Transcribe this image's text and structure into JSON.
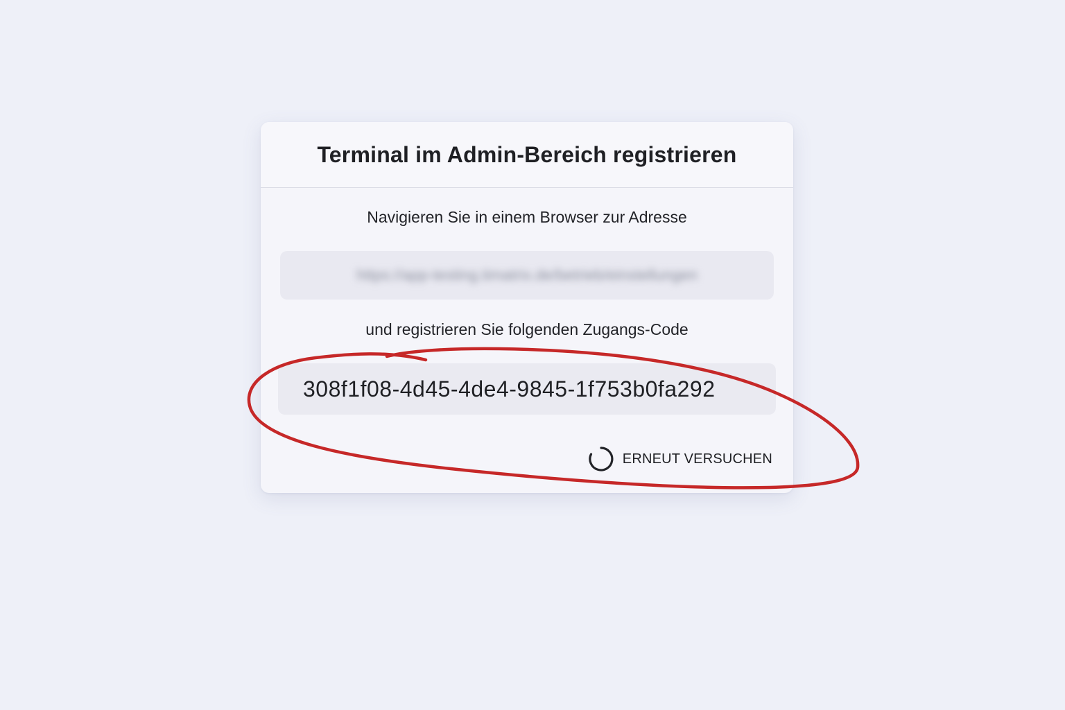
{
  "dialog": {
    "title": "Terminal im Admin-Bereich registrieren",
    "instruction_1": "Navigieren Sie in einem Browser zur Adresse",
    "url_blurred": "https://app-testing.timatrix.de/betrieb/einstellungen",
    "instruction_2": "und registrieren Sie folgenden Zugangs-Code",
    "access_code": "308f1f08-4d45-4de4-9845-1f753b0fa292",
    "retry_label": "ERNEUT VERSUCHEN"
  },
  "icons": {
    "spinner": "loading-spinner-icon"
  },
  "colors": {
    "background": "#eef0f8",
    "card": "#f5f5fa",
    "annotation": "#c62828",
    "text": "#1f2024"
  }
}
